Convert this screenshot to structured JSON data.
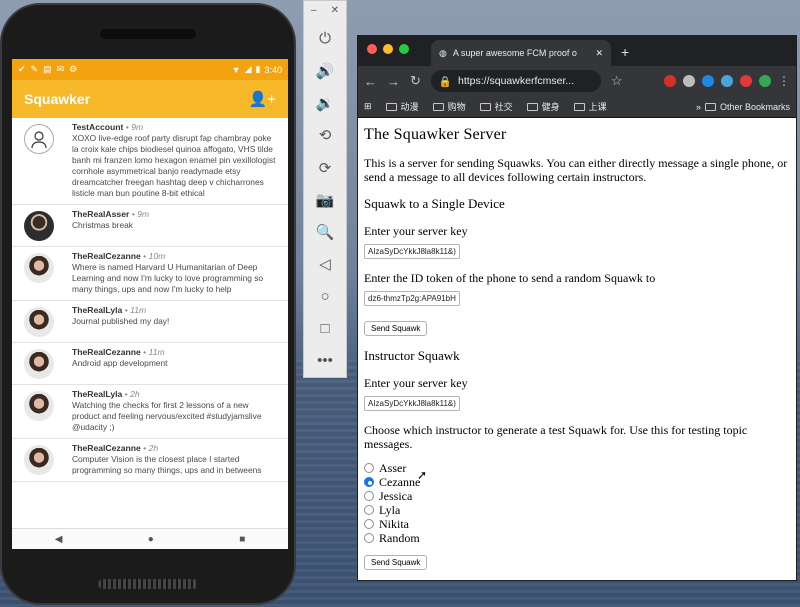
{
  "phone": {
    "status_time": "3:40",
    "app_title": "Squawker",
    "posts": [
      {
        "author": "TestAccount",
        "time": "9m",
        "avatar": "outline",
        "text": "XOXO live-edge roof party disrupt fap chambray poke la croix kale chips biodiesel quinoa affogato, VHS tilde banh mi franzen lomo hexagon enamel pin vexillologist cornhole asymmetrical banjo readymade etsy dreamcatcher freegan hashtag deep v chicharrones listicle man bun poutine 8-bit ethical"
      },
      {
        "author": "TheRealAsser",
        "time": "9m",
        "avatar": "m",
        "text": "Christmas break"
      },
      {
        "author": "TheRealCezanne",
        "time": "10m",
        "avatar": "f",
        "text": "Where is named Harvard U Humanitarian of Deep Learning and now I'm lucky to love programming so many things, ups and now I'm lucky to help"
      },
      {
        "author": "TheRealLyla",
        "time": "11m",
        "avatar": "f",
        "text": "Journal published my day!"
      },
      {
        "author": "TheRealCezanne",
        "time": "11m",
        "avatar": "f",
        "text": "Android app development"
      },
      {
        "author": "TheRealLyla",
        "time": "2h",
        "avatar": "f",
        "text": "Watching the checks for first 2 lessons of a new product and feeling nervous/excited #studyjamslive @udacity ;)"
      },
      {
        "author": "TheRealCezanne",
        "time": "2h",
        "avatar": "f",
        "text": "Computer Vision is the closest place I started programming so many things, ups and in betweens"
      }
    ]
  },
  "toolbar": {
    "items": [
      "power-icon",
      "volume-up-icon",
      "volume-down-icon",
      "rotate-left-icon",
      "rotate-right-icon",
      "camera-icon",
      "zoom-icon",
      "back-icon",
      "home-icon",
      "overview-icon",
      "more-icon"
    ]
  },
  "browser": {
    "tab_title": "A super awesome FCM proof o",
    "url": "https://squawkerfcmser...",
    "bookmarks": [
      "动漫",
      "购物",
      "社交",
      "健身",
      "上课"
    ],
    "other_bookmarks": "Other Bookmarks"
  },
  "page": {
    "title": "The Squawker Server",
    "intro": "This is a server for sending Squawks. You can either directly message a single phone, or send a message to all devices following certain instructors.",
    "single_heading": "Squawk to a Single Device",
    "server_key_label": "Enter your server key",
    "server_key_value": "AIzaSyDcYkkJ8la8k11&)",
    "token_label": "Enter the ID token of the phone to send a random Squawk to",
    "token_value": "dz6-thmzTp2g:APA91bH",
    "send_label": "Send Squawk",
    "instructor_heading": "Instructor Squawk",
    "server_key_label_2": "Enter your server key",
    "server_key_value_2": "AIzaSyDcYkkJ8la8k11&)",
    "choose_text": "Choose which instructor to generate a test Squawk for. Use this for testing topic messages.",
    "instructors": [
      {
        "name": "Asser",
        "checked": false
      },
      {
        "name": "Cezanne",
        "checked": true
      },
      {
        "name": "Jessica",
        "checked": false
      },
      {
        "name": "Lyla",
        "checked": false
      },
      {
        "name": "Nikita",
        "checked": false
      },
      {
        "name": "Random",
        "checked": false
      }
    ],
    "send_label_2": "Send Squawk"
  },
  "colors": {
    "app_bar": "#f7b82a",
    "status_bar": "#f3a30f",
    "radio_selected": "#1a73e8"
  }
}
